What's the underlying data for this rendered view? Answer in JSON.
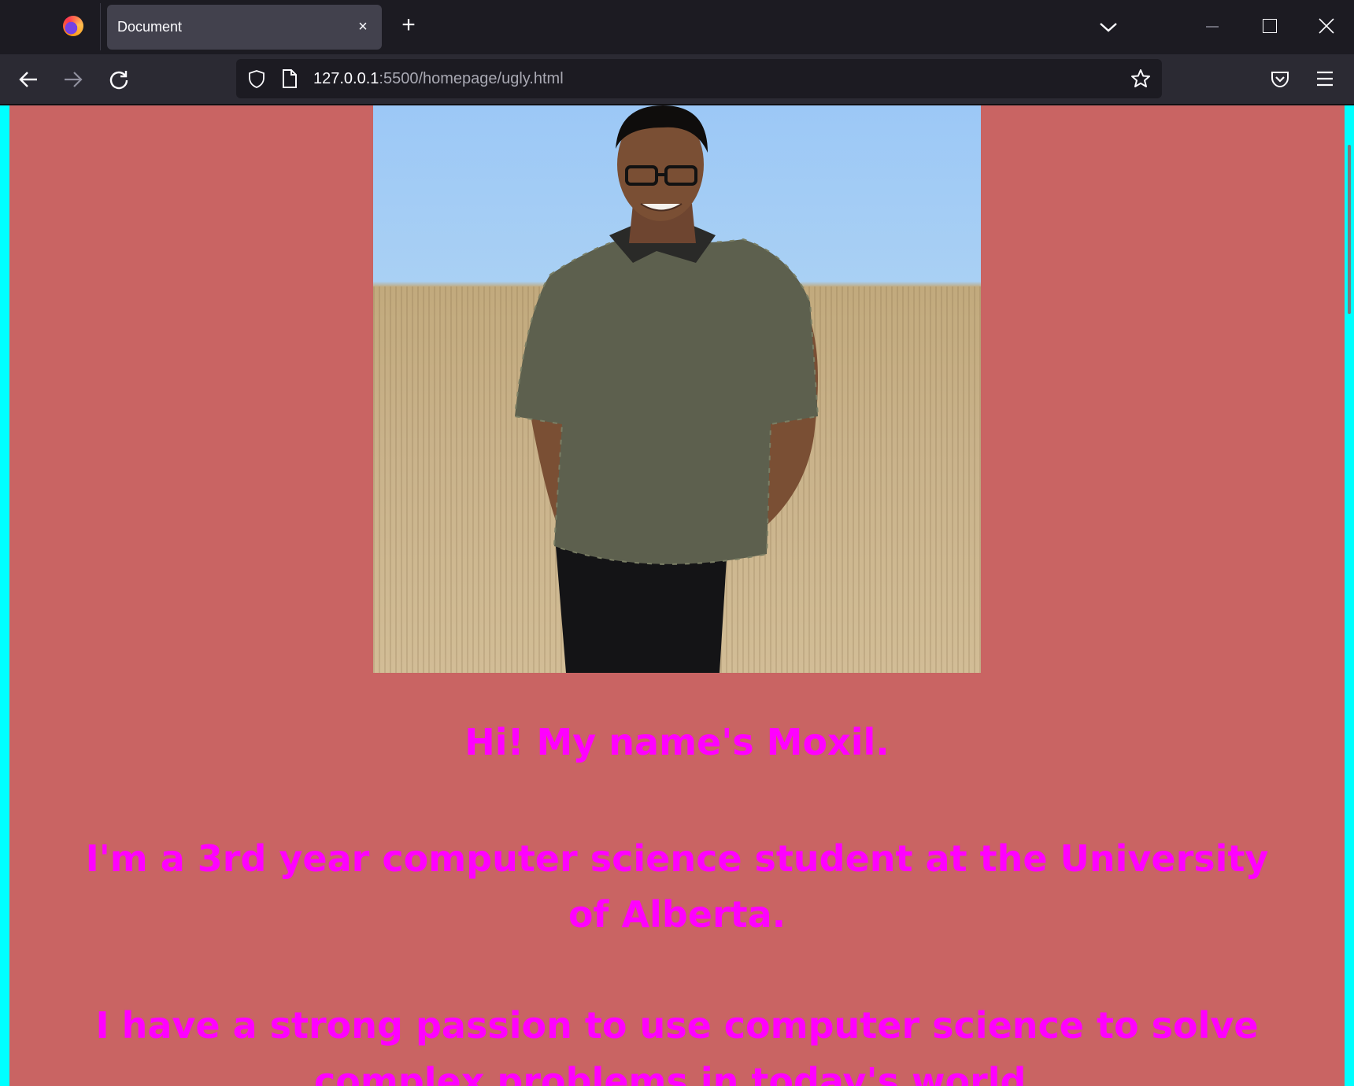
{
  "browser": {
    "tab": {
      "title": "Document"
    },
    "url": {
      "host": "127.0.0.1",
      "rest": ":5500/homepage/ugly.html"
    }
  },
  "page": {
    "photo_alt": "",
    "heading": "Hi! My name's Moxil.",
    "paragraph1": "I'm a 3rd year computer science student at the University of Alberta.",
    "paragraph2": "I have a strong passion to use computer science to solve complex problems in today's world."
  },
  "colors": {
    "page_background": "#c96463",
    "text": "#ff00ff",
    "border": "#00ffff"
  }
}
